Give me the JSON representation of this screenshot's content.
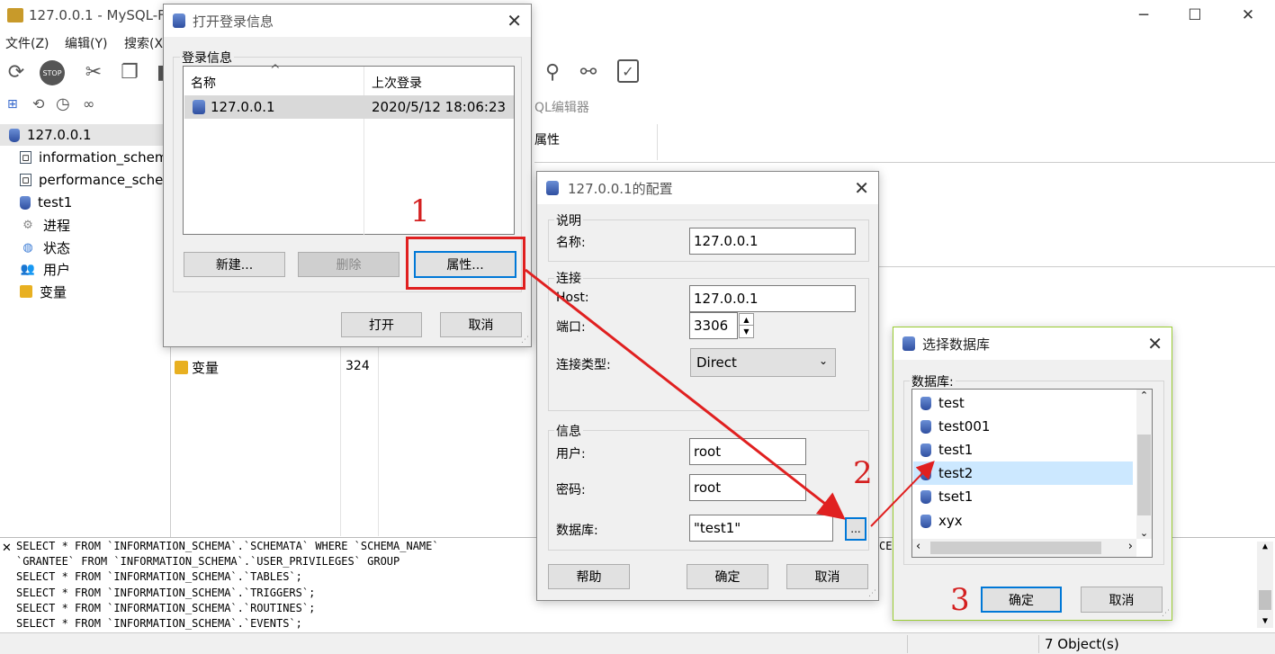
{
  "app": {
    "title": "127.0.0.1 - MySQL-Fr"
  },
  "window_controls": {
    "minimize": "─",
    "maximize": "☐",
    "close": "✕"
  },
  "menu": {
    "file": "文件(Z)",
    "edit": "编辑(Y)",
    "search": "搜索(X"
  },
  "tree": {
    "root": "127.0.0.1",
    "items": [
      "information_schem",
      "performance_sche",
      "test1",
      "进程",
      "状态",
      "用户",
      "变量"
    ]
  },
  "main": {
    "sql_editor_tab": "QL编辑器",
    "prop_header": "属性",
    "var_row": {
      "name": "变量",
      "value": "324"
    }
  },
  "login_dialog": {
    "title": "打开登录信息",
    "group_label": "登录信息",
    "col_name": "名称",
    "col_last": "上次登录",
    "row_name": "127.0.0.1",
    "row_last": "2020/5/12 18:06:23",
    "btn_new": "新建...",
    "btn_delete": "删除",
    "btn_props": "属性...",
    "btn_open": "打开",
    "btn_cancel": "取消"
  },
  "config_dialog": {
    "title": "127.0.0.1的配置",
    "desc_group": "说明",
    "name_label": "名称:",
    "name_value": "127.0.0.1",
    "conn_group": "连接",
    "host_label": "Host:",
    "host_value": "127.0.0.1",
    "port_label": "端口:",
    "port_value": "3306",
    "conn_type_label": "连接类型:",
    "conn_type_value": "Direct",
    "info_group": "信息",
    "user_label": "用户:",
    "user_value": "root",
    "pwd_label": "密码:",
    "pwd_value": "root",
    "db_label": "数据库:",
    "db_value": "\"test1\"",
    "browse": "...",
    "btn_help": "帮助",
    "btn_ok": "确定",
    "btn_cancel": "取消"
  },
  "select_db_dialog": {
    "title": "选择数据库",
    "list_label": "数据库:",
    "items": [
      "test",
      "test001",
      "test1",
      "test2",
      "tset1",
      "xyx"
    ],
    "selected_index": 3,
    "btn_ok": "确定",
    "btn_cancel": "取消"
  },
  "sql_log": [
    "SELECT * FROM `INFORMATION_SCHEMA`.`SCHEMATA` WHERE `SCHEMA_NAME`",
    "`GRANTEE` FROM `INFORMATION_SCHEMA`.`USER_PRIVILEGES` GROUP",
    "SELECT * FROM `INFORMATION_SCHEMA`.`TABLES`;",
    "SELECT * FROM `INFORMATION_SCHEMA`.`TRIGGERS`;",
    "SELECT * FROM `INFORMATION_SCHEMA`.`ROUTINES`;",
    "SELECT * FROM `INFORMATION_SCHEMA`.`EVENTS`;"
  ],
  "sql_log_tail": "CE",
  "status": {
    "objects": "7 Object(s)"
  },
  "annotations": {
    "step1": "1",
    "step2": "2",
    "step3": "3"
  },
  "colors": {
    "annotation_red": "#e02020",
    "selection": "#cce8ff",
    "focus_blue": "#0078d7"
  }
}
